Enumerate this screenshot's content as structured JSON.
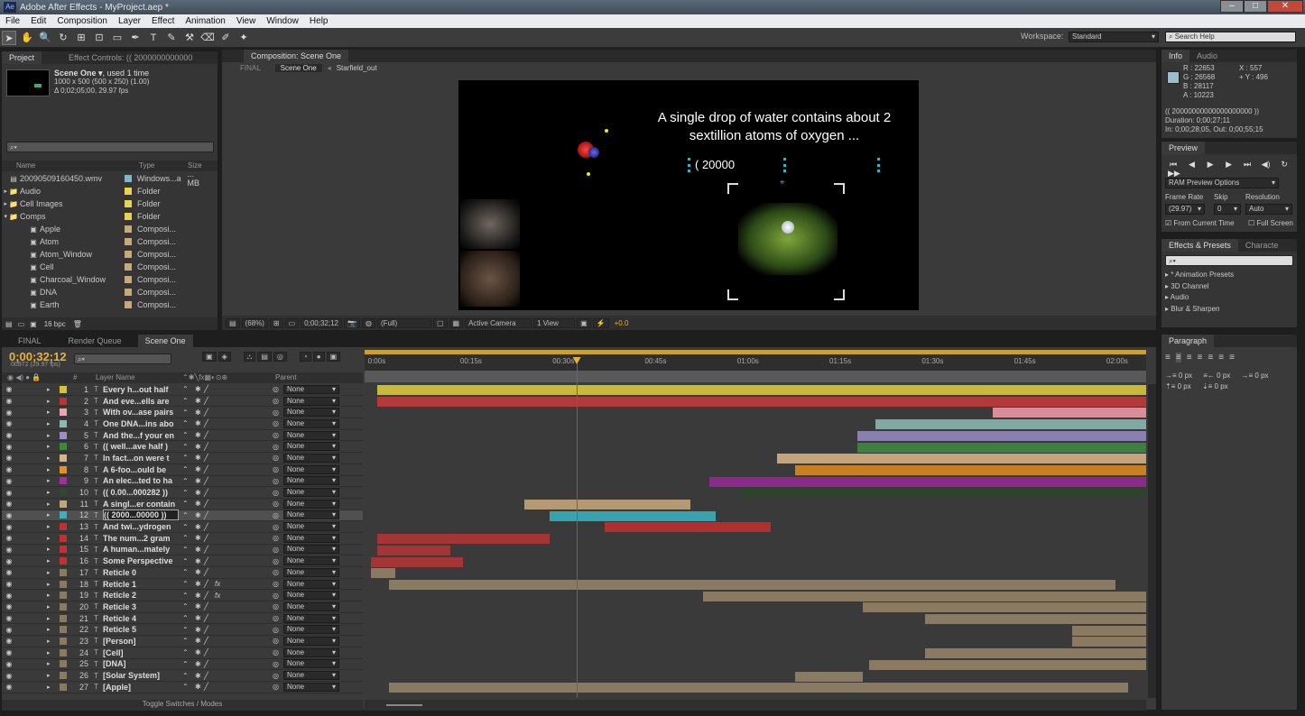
{
  "window": {
    "title": "Adobe After Effects - MyProject.aep *",
    "min": "–",
    "max": "□",
    "close": "✕"
  },
  "menu": [
    "File",
    "Edit",
    "Composition",
    "Layer",
    "Effect",
    "Animation",
    "View",
    "Window",
    "Help"
  ],
  "workspace": {
    "label": "Workspace:",
    "value": "Standard",
    "search_placeholder": "Search Help"
  },
  "project": {
    "tab_project": "Project",
    "tab_effects": "Effect Controls: (( 2000000000000",
    "item_name": "Scene One ▾",
    "item_used": ", used 1 time",
    "item_size": "1000 x 500  (500 x 250) (1.00)",
    "item_duration": "Δ 0;02;05;00, 29.97 fps",
    "col_name": "Name",
    "col_type": "Type",
    "col_size": "Size",
    "bpc": "16 bpc",
    "items": [
      {
        "name": "20090509160450.wmv",
        "type": "Windows...a",
        "size": "... MB",
        "color": "#7fb8c8",
        "indent": 0,
        "kind": "file"
      },
      {
        "name": "Audio",
        "type": "Folder",
        "color": "#e8d350",
        "indent": 0,
        "kind": "folder"
      },
      {
        "name": "Cell Images",
        "type": "Folder",
        "color": "#e8d350",
        "indent": 0,
        "kind": "folder"
      },
      {
        "name": "Comps",
        "type": "Folder",
        "color": "#e8d350",
        "indent": 0,
        "kind": "folder-open"
      },
      {
        "name": "Apple",
        "type": "Composi...",
        "color": "#c9a97a",
        "indent": 1,
        "kind": "comp"
      },
      {
        "name": "Atom",
        "type": "Composi...",
        "color": "#c9a97a",
        "indent": 1,
        "kind": "comp"
      },
      {
        "name": "Atom_Window",
        "type": "Composi...",
        "color": "#c9a97a",
        "indent": 1,
        "kind": "comp"
      },
      {
        "name": "Cell",
        "type": "Composi...",
        "color": "#c9a97a",
        "indent": 1,
        "kind": "comp"
      },
      {
        "name": "Charcoal_Window",
        "type": "Composi...",
        "color": "#c9a97a",
        "indent": 1,
        "kind": "comp"
      },
      {
        "name": "DNA",
        "type": "Composi...",
        "color": "#c9a97a",
        "indent": 1,
        "kind": "comp"
      },
      {
        "name": "Earth",
        "type": "Composi...",
        "color": "#c9a97a",
        "indent": 1,
        "kind": "comp"
      }
    ]
  },
  "composition": {
    "tab": "Composition: Scene One",
    "crumbs": [
      "FINAL",
      "Scene One",
      "Starfield_out"
    ],
    "caption_line1": "A single drop of water contains about 2",
    "caption_line2": "sextillion atoms of oxygen ...",
    "counter_text": "( 20000",
    "zoom": "(68%)",
    "timecode": "0;00;32;12",
    "resolution": "(Full)",
    "camera": "Active Camera",
    "view": "1 View",
    "exposure": "+0.0"
  },
  "info": {
    "tab_info": "Info",
    "tab_audio": "Audio",
    "r": "R :  22653",
    "g": "G :  26568",
    "b": "B :  28117",
    "a": "A :  10223",
    "x": "X : 557",
    "y": "+ Y : 496",
    "layer": "(( 20000000000000000000 ))",
    "duration": "Duration: 0;00;27;11",
    "inout": "In: 0;00;28;05, Out: 0;00;55;15"
  },
  "preview": {
    "tab": "Preview",
    "ram_options": "RAM Preview Options",
    "frame_rate_label": "Frame Rate",
    "skip_label": "Skip",
    "resolution_label": "Resolution",
    "frame_rate": "(29.97)",
    "skip": "0",
    "resolution": "Auto",
    "from_current": "From Current Time",
    "full_screen": "Full Screen"
  },
  "effects": {
    "tab": "Effects & Presets",
    "tab2": "Characte",
    "items": [
      "* Animation Presets",
      "3D Channel",
      "Audio",
      "Blur & Sharpen"
    ]
  },
  "paragraph": {
    "tab": "Paragraph",
    "v1": "0 px",
    "v2": "0 px",
    "v3": "0 px",
    "v4": "0 px",
    "v5": "0 px"
  },
  "timeline": {
    "tabs": [
      "FINAL",
      "Render Queue",
      "Scene One"
    ],
    "timecode": "0;00;32;12",
    "frame": "00972 (29.97 fps)",
    "col_layer_name": "Layer Name",
    "col_parent": "Parent",
    "toggle_label": "Toggle Switches / Modes",
    "ruler": [
      "0:00s",
      "00:15s",
      "00:30s",
      "00:45s",
      "01:00s",
      "01:15s",
      "01:30s",
      "01:45s",
      "02:00s"
    ],
    "layers": [
      {
        "num": "1",
        "name": "Every h...out half",
        "color": "#d4c430",
        "bar_color": "#c9b93a",
        "start": 0,
        "end": 125,
        "parent": "None"
      },
      {
        "num": "2",
        "name": "And eve...ells are",
        "color": "#b33",
        "bar_color": "#b33a3a",
        "start": 0,
        "end": 125,
        "parent": "None"
      },
      {
        "num": "3",
        "name": "With ov...ase pairs",
        "color": "#e9a7b3",
        "bar_color": "#d98e99",
        "start": 100,
        "end": 125,
        "parent": "None"
      },
      {
        "num": "4",
        "name": "One DNA...ins abo",
        "color": "#8fb8b0",
        "bar_color": "#7faaa2",
        "start": 81,
        "end": 125,
        "parent": "None"
      },
      {
        "num": "5",
        "name": "And the...f your en",
        "color": "#9a8fc8",
        "bar_color": "#8a80b0",
        "start": 78,
        "end": 125,
        "parent": "None"
      },
      {
        "num": "6",
        "name": "(( well...ave half )",
        "color": "#3a8a3a",
        "bar_color": "#3e7e3e",
        "start": 78,
        "end": 125,
        "parent": "None"
      },
      {
        "num": "7",
        "name": "In fact...on were t",
        "color": "#d4b48a",
        "bar_color": "#c4a47a",
        "start": 65,
        "end": 125,
        "parent": "None"
      },
      {
        "num": "8",
        "name": "A 6-foo...ould be",
        "color": "#e89020",
        "bar_color": "#c98020",
        "start": 68,
        "end": 125,
        "parent": "None"
      },
      {
        "num": "9",
        "name": "An elec...ted to ha",
        "color": "#a030a0",
        "bar_color": "#8a2a8a",
        "start": 54,
        "end": 125,
        "parent": "None"
      },
      {
        "num": "10",
        "name": "(( 0.00...000282 ))",
        "color": "#2e4a2e",
        "bar_color": "#2c442c",
        "start": 59,
        "end": 125,
        "parent": "None"
      },
      {
        "num": "11",
        "name": "A singl...er contain",
        "color": "#c4a47a",
        "bar_color": "#b39a74",
        "start": 24,
        "end": 51,
        "parent": "None"
      },
      {
        "num": "12",
        "name": "(( 2000...00000 ))",
        "color": "#3ab0c0",
        "bar_color": "#36a3b0",
        "start": 28,
        "end": 55,
        "parent": "None",
        "selected": true
      },
      {
        "num": "13",
        "name": "And twi...ydrogen",
        "color": "#c23030",
        "bar_color": "#b03030",
        "start": 37,
        "end": 64,
        "parent": "None"
      },
      {
        "num": "14",
        "name": "The num...2 gram",
        "color": "#c23030",
        "bar_color": "#a53535",
        "start": 0,
        "end": 28,
        "parent": "None"
      },
      {
        "num": "15",
        "name": "A human...mately",
        "color": "#c23030",
        "bar_color": "#a53535",
        "start": 0,
        "end": 12,
        "parent": "None"
      },
      {
        "num": "16",
        "name": "Some Perspective",
        "color": "#c23030",
        "bar_color": "#a53535",
        "start": -1,
        "end": 14,
        "parent": "None"
      },
      {
        "num": "17",
        "name": "Reticle 0",
        "color": "#8a7a60",
        "bar_color": "#8a7a62",
        "start": -1,
        "end": 3,
        "parent": "None"
      },
      {
        "num": "18",
        "name": "Reticle 1",
        "color": "#8a7a60",
        "bar_color": "#8a7a62",
        "start": 2,
        "end": 120,
        "parent": "None",
        "fx": true
      },
      {
        "num": "19",
        "name": "Reticle 2",
        "color": "#8a7a60",
        "bar_color": "#8a7a62",
        "start": 53,
        "end": 125,
        "parent": "None",
        "fx": true
      },
      {
        "num": "20",
        "name": "Reticle 3",
        "color": "#8a7a60",
        "bar_color": "#8a7a62",
        "start": 79,
        "end": 125,
        "parent": "None"
      },
      {
        "num": "21",
        "name": "Reticle 4",
        "color": "#8a7a60",
        "bar_color": "#8a7a62",
        "start": 89,
        "end": 125,
        "parent": "None"
      },
      {
        "num": "22",
        "name": "Reticle 5",
        "color": "#8a7a60",
        "bar_color": "#8a7a62",
        "start": 113,
        "end": 125,
        "parent": "None"
      },
      {
        "num": "23",
        "name": "[Person]",
        "color": "#8a7a60",
        "bar_color": "#8a7a62",
        "start": 113,
        "end": 125,
        "parent": "None"
      },
      {
        "num": "24",
        "name": "[Cell]",
        "color": "#8a7a60",
        "bar_color": "#8a7a62",
        "start": 89,
        "end": 125,
        "parent": "None"
      },
      {
        "num": "25",
        "name": "[DNA]",
        "color": "#8a7a60",
        "bar_color": "#8a7a62",
        "start": 80,
        "end": 125,
        "parent": "None"
      },
      {
        "num": "26",
        "name": "[Solar System]",
        "color": "#8a7a60",
        "bar_color": "#8a7a62",
        "start": 68,
        "end": 79,
        "parent": "None"
      },
      {
        "num": "27",
        "name": "[Apple]",
        "color": "#8a7a60",
        "bar_color": "#8a7a62",
        "start": 2,
        "end": 122,
        "parent": "None"
      }
    ],
    "playhead_seconds": 32.4,
    "total_seconds": 125
  }
}
